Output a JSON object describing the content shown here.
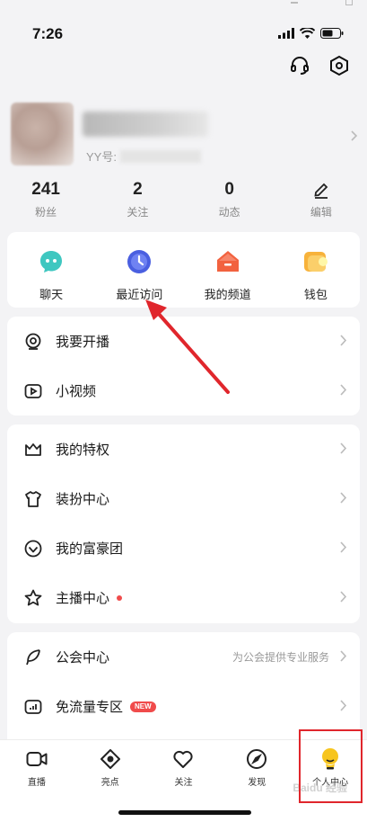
{
  "status_bar": {
    "time": "7:26"
  },
  "profile": {
    "yy_label": "YY号:"
  },
  "stats": [
    {
      "value": "241",
      "label": "粉丝"
    },
    {
      "value": "2",
      "label": "关注"
    },
    {
      "value": "0",
      "label": "动态"
    },
    {
      "value": "",
      "label": "编辑",
      "icon": "edit-icon"
    }
  ],
  "quick_actions": [
    {
      "label": "聊天",
      "icon": "chat-icon",
      "color": "#3fc7c0"
    },
    {
      "label": "最近访问",
      "icon": "clock-icon",
      "color": "#4a5fe0"
    },
    {
      "label": "我的频道",
      "icon": "home-icon",
      "color": "#f2623f"
    },
    {
      "label": "钱包",
      "icon": "wallet-icon",
      "color": "#f7b23b"
    }
  ],
  "menu_group1": [
    {
      "label": "我要开播",
      "icon": "broadcast-icon"
    },
    {
      "label": "小视频",
      "icon": "video-play-icon"
    }
  ],
  "menu_group2": [
    {
      "label": "我的特权",
      "icon": "crown-icon"
    },
    {
      "label": "装扮中心",
      "icon": "shirt-icon"
    },
    {
      "label": "我的富豪团",
      "icon": "diamond-icon"
    },
    {
      "label": "主播中心",
      "icon": "star-icon"
    }
  ],
  "menu_group3": [
    {
      "label": "公会中心",
      "icon": "feather-icon",
      "subtitle": "为公会提供专业服务"
    },
    {
      "label": "免流量专区",
      "icon": "data-icon",
      "badge": "NEW"
    }
  ],
  "tabbar": [
    {
      "label": "直播",
      "icon": "camera-icon"
    },
    {
      "label": "亮点",
      "icon": "eye-icon"
    },
    {
      "label": "关注",
      "icon": "heart-icon"
    },
    {
      "label": "发现",
      "icon": "compass-icon"
    },
    {
      "label": "个人中心",
      "icon": "profile-bulb-icon",
      "active": true
    }
  ],
  "watermark": "Baidu 经验",
  "colors": {
    "accent": "#f7c51e",
    "annotation_red": "#e0262c",
    "badge_red": "#f04b4b"
  }
}
